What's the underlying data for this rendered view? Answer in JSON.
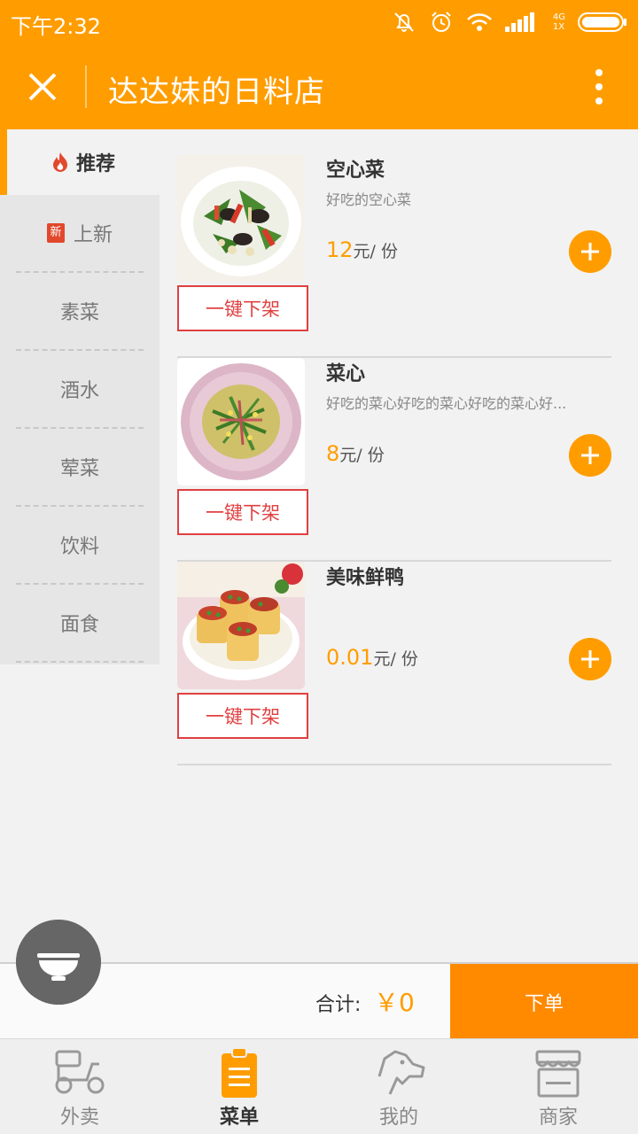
{
  "status_bar": {
    "time": "下午2:32",
    "network": "4G",
    "network_sub": "1X"
  },
  "header": {
    "title": "达达妹的日料店"
  },
  "sidebar": {
    "active": "推荐",
    "items": [
      {
        "label": "上新",
        "badge": "新"
      },
      {
        "label": "素菜"
      },
      {
        "label": "酒水"
      },
      {
        "label": "荤菜"
      },
      {
        "label": "饮料"
      },
      {
        "label": "面食"
      }
    ]
  },
  "dishes": [
    {
      "name": "空心菜",
      "desc": "好吃的空心菜",
      "price": "12",
      "unit": "元/ 份",
      "action": "一键下架"
    },
    {
      "name": "菜心",
      "desc": "好吃的菜心好吃的菜心好吃的菜心好...",
      "price": "8",
      "unit": "元/ 份",
      "action": "一键下架"
    },
    {
      "name": "美味鲜鸭",
      "desc": "",
      "price": "0.01",
      "unit": "元/ 份",
      "action": "一键下架"
    }
  ],
  "cart": {
    "total_label": "合计:",
    "total_value": "￥0",
    "order_label": "下单"
  },
  "tabs": [
    {
      "label": "外卖",
      "icon": "scooter-icon"
    },
    {
      "label": "菜单",
      "icon": "menu-clipboard-icon",
      "active": true
    },
    {
      "label": "我的",
      "icon": "dog-icon"
    },
    {
      "label": "商家",
      "icon": "shop-icon"
    }
  ],
  "colors": {
    "accent": "#ff9d00",
    "danger": "#e04040",
    "order": "#ff8a00"
  }
}
